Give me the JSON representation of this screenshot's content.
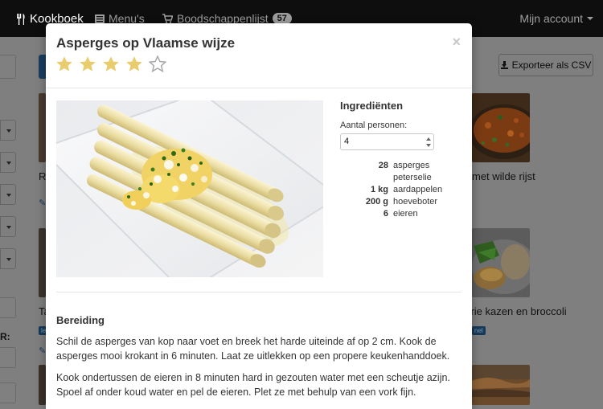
{
  "navbar": {
    "brand": "Kookboek",
    "menus": "Menu's",
    "shopping_list": "Boodschappenlijst",
    "shopping_count": "57",
    "account": "Mijn account"
  },
  "background": {
    "export_button": "Exporteer als CSV",
    "recipe_right_1": "met wilde rijst",
    "recipe_right_2": "t drie kazen en broccoli",
    "recipe_left_1": "R",
    "recipe_left_2": "Ta",
    "label_left": "le",
    "label_right": "nel",
    "sidebar_r": "R:"
  },
  "modal": {
    "title": "Asperges op Vlaamse wijze",
    "rating": 4,
    "rating_max": 5,
    "star_color_filled": "#e8cc6d",
    "star_color_empty": "#a8a8a8",
    "ingredients_heading": "Ingrediënten",
    "persons_label": "Aantal personen:",
    "persons_value": "4",
    "ingredients": [
      {
        "qty": "28",
        "name": "asperges"
      },
      {
        "qty": "",
        "name": "peterselie"
      },
      {
        "qty": "1 kg",
        "name": "aardappelen"
      },
      {
        "qty": "200 g",
        "name": "hoeveboter"
      },
      {
        "qty": "6",
        "name": "eieren"
      }
    ],
    "preparation_heading": "Bereiding",
    "preparation_steps": [
      "Schil de asperges van kop naar voet en breek het harde uiteinde af op 2 cm. Kook de asperges mooi krokant in 6 minuten. Laat ze uitlekken op een propere keukenhanddoek.",
      "Kook ondertussen de eieren in 8 minuten hard in gezouten water met een scheutje azijn. Spoel af onder koud water en pel de eieren. Plet ze met behulp van een vork fijn."
    ]
  }
}
